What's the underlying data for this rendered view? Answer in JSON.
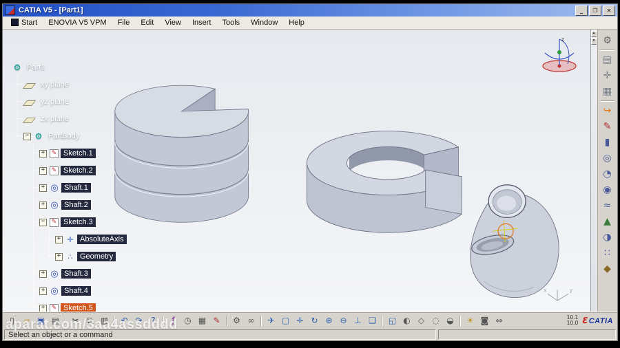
{
  "window": {
    "title": "CATIA V5 - [Part1]",
    "minimize": "_",
    "maximize": "❐",
    "close": "✕"
  },
  "menu": {
    "items": [
      "Start",
      "ENOVIA V5 VPM",
      "File",
      "Edit",
      "View",
      "Insert",
      "Tools",
      "Window",
      "Help"
    ]
  },
  "tree": {
    "icon_glyphs": {
      "part": "⚙",
      "plane": "",
      "body": "⚙",
      "sketch": "✎",
      "shaft": "◎",
      "axis": "✛",
      "geometry": "∴"
    },
    "items": [
      {
        "label": "Part1",
        "level": 0,
        "icon": "part",
        "expander": null,
        "style": "plain"
      },
      {
        "label": "xy plane",
        "level": 1,
        "icon": "plane",
        "expander": null,
        "style": "plain"
      },
      {
        "label": "yz plane",
        "level": 1,
        "icon": "plane",
        "expander": null,
        "style": "plain"
      },
      {
        "label": "zx plane",
        "level": 1,
        "icon": "plane",
        "expander": null,
        "style": "plain"
      },
      {
        "label": "PartBody",
        "level": 1,
        "icon": "body",
        "expander": "minus",
        "style": "plain"
      },
      {
        "label": "Sketch.1",
        "level": 2,
        "icon": "sketch",
        "expander": "plus",
        "style": "boxed"
      },
      {
        "label": "Sketch.2",
        "level": 2,
        "icon": "sketch",
        "expander": "plus",
        "style": "boxed"
      },
      {
        "label": "Shaft.1",
        "level": 2,
        "icon": "shaft",
        "expander": "plus",
        "style": "boxed"
      },
      {
        "label": "Shaft.2",
        "level": 2,
        "icon": "shaft",
        "expander": "plus",
        "style": "boxed"
      },
      {
        "label": "Sketch.3",
        "level": 2,
        "icon": "sketch",
        "expander": "minus",
        "style": "boxed"
      },
      {
        "label": "AbsoluteAxis",
        "level": 3,
        "icon": "axis",
        "expander": "plus",
        "style": "boxed"
      },
      {
        "label": "Geometry",
        "level": 3,
        "icon": "geometry",
        "expander": "plus",
        "style": "boxed"
      },
      {
        "label": "Shaft.3",
        "level": 2,
        "icon": "shaft",
        "expander": "plus",
        "style": "boxed"
      },
      {
        "label": "Shaft.4",
        "level": 2,
        "icon": "shaft",
        "expander": "plus",
        "style": "boxed"
      },
      {
        "label": "Sketch.5",
        "level": 2,
        "icon": "sketch",
        "expander": "plus",
        "style": "selected"
      }
    ]
  },
  "right_toolbar": {
    "items": [
      {
        "name": "view-mode-gear",
        "glyph": "⚙",
        "color": "#666666",
        "divider_after": true
      },
      {
        "name": "frame-display",
        "glyph": "▤",
        "color": "#7a7f8a"
      },
      {
        "name": "axis-system",
        "glyph": "✛",
        "color": "#7a7f8a"
      },
      {
        "name": "grid-display",
        "glyph": "▦",
        "color": "#7a7f8a",
        "divider_after": true
      },
      {
        "name": "exit-workbench",
        "glyph": "↪",
        "color": "#e07818"
      },
      {
        "name": "sketcher",
        "glyph": "✎",
        "color": "#b03030"
      },
      {
        "name": "pad",
        "glyph": "▮",
        "color": "#4a5a9a"
      },
      {
        "name": "shaft-tool",
        "glyph": "◎",
        "color": "#4a5a9a"
      },
      {
        "name": "groove",
        "glyph": "◔",
        "color": "#4a5a9a"
      },
      {
        "name": "hole",
        "glyph": "◉",
        "color": "#4a5a9a"
      },
      {
        "name": "rib",
        "glyph": "≈",
        "color": "#4a5a9a"
      },
      {
        "name": "stiffener",
        "glyph": "▲",
        "color": "#3a7a3a"
      },
      {
        "name": "mirror",
        "glyph": "◑",
        "color": "#4a5a9a"
      },
      {
        "name": "pattern",
        "glyph": "∷",
        "color": "#4a5a9a"
      },
      {
        "name": "apply-material",
        "glyph": "◆",
        "color": "#8a6a2a"
      }
    ]
  },
  "bottom_toolbar": {
    "items": [
      {
        "name": "new-document",
        "glyph": "▯",
        "color": "#444444"
      },
      {
        "name": "open-folder",
        "glyph": "▱",
        "color": "#c09020"
      },
      {
        "name": "save",
        "glyph": "▣",
        "color": "#3858b0"
      },
      {
        "name": "print",
        "glyph": "▤",
        "color": "#555555",
        "divider_after": true
      },
      {
        "name": "cut",
        "glyph": "✂",
        "color": "#444444"
      },
      {
        "name": "copy",
        "glyph": "⧉",
        "color": "#444444"
      },
      {
        "name": "paste",
        "glyph": "▥",
        "color": "#444444",
        "divider_after": true
      },
      {
        "name": "undo",
        "glyph": "↶",
        "color": "#3060b0"
      },
      {
        "name": "redo",
        "glyph": "↷",
        "color": "#3060b0"
      },
      {
        "name": "help",
        "glyph": "?",
        "color": "#3060b0",
        "divider_after": true
      },
      {
        "name": "knowledge-fx",
        "glyph": "ƒ",
        "color": "#8a30a0"
      },
      {
        "name": "history",
        "glyph": "◷",
        "color": "#555555"
      },
      {
        "name": "table-grid",
        "glyph": "▦",
        "color": "#555555"
      },
      {
        "name": "annotation-pen",
        "glyph": "✎",
        "color": "#a83030",
        "divider_after": true
      },
      {
        "name": "options-gear",
        "glyph": "⚙",
        "color": "#555555"
      },
      {
        "name": "link-manager",
        "glyph": "∞",
        "color": "#555555",
        "divider_after": true
      },
      {
        "name": "fly-mode",
        "glyph": "✈",
        "color": "#3060b0"
      },
      {
        "name": "fit-all-in",
        "glyph": "▢",
        "color": "#3060b0"
      },
      {
        "name": "pan",
        "glyph": "✛",
        "color": "#3060b0"
      },
      {
        "name": "rotate",
        "glyph": "↻",
        "color": "#3060b0"
      },
      {
        "name": "zoom-in",
        "glyph": "⊕",
        "color": "#3060b0"
      },
      {
        "name": "zoom-out",
        "glyph": "⊖",
        "color": "#3060b0"
      },
      {
        "name": "normal-view",
        "glyph": "⊥",
        "color": "#3060b0"
      },
      {
        "name": "multi-view",
        "glyph": "❏",
        "color": "#3060b0",
        "divider_after": true
      },
      {
        "name": "named-views",
        "glyph": "◱",
        "color": "#3060b0"
      },
      {
        "name": "shading-mode",
        "glyph": "◐",
        "color": "#555555"
      },
      {
        "name": "wireframe",
        "glyph": "◇",
        "color": "#555555"
      },
      {
        "name": "hide-show",
        "glyph": "◌",
        "color": "#555555"
      },
      {
        "name": "swap-visible-space",
        "glyph": "◒",
        "color": "#555555",
        "divider_after": true
      },
      {
        "name": "light-effect",
        "glyph": "☀",
        "color": "#c09020"
      },
      {
        "name": "snapshot",
        "glyph": "◙",
        "color": "#555555"
      },
      {
        "name": "measure",
        "glyph": "⇔",
        "color": "#555555"
      }
    ],
    "zoom_readout": {
      "line1": "10.1",
      "line2": "10.0"
    },
    "logo": {
      "mark": "Ɛ",
      "text": "CATIA"
    }
  },
  "status_bar": {
    "message": "Select an object or a command",
    "secondary": ""
  },
  "watermark": {
    "text": "aparat.com/3aa4assdddd"
  },
  "viewport": {
    "compass_z_label": "z",
    "axis_x_label": "x",
    "axis_y_label": "y"
  },
  "colors": {
    "titlebar_blue": "#2250c4",
    "selection_orange": "#d2571e",
    "tree_box_navy": "#0d132a",
    "solid_fill": "#cdd2de"
  }
}
